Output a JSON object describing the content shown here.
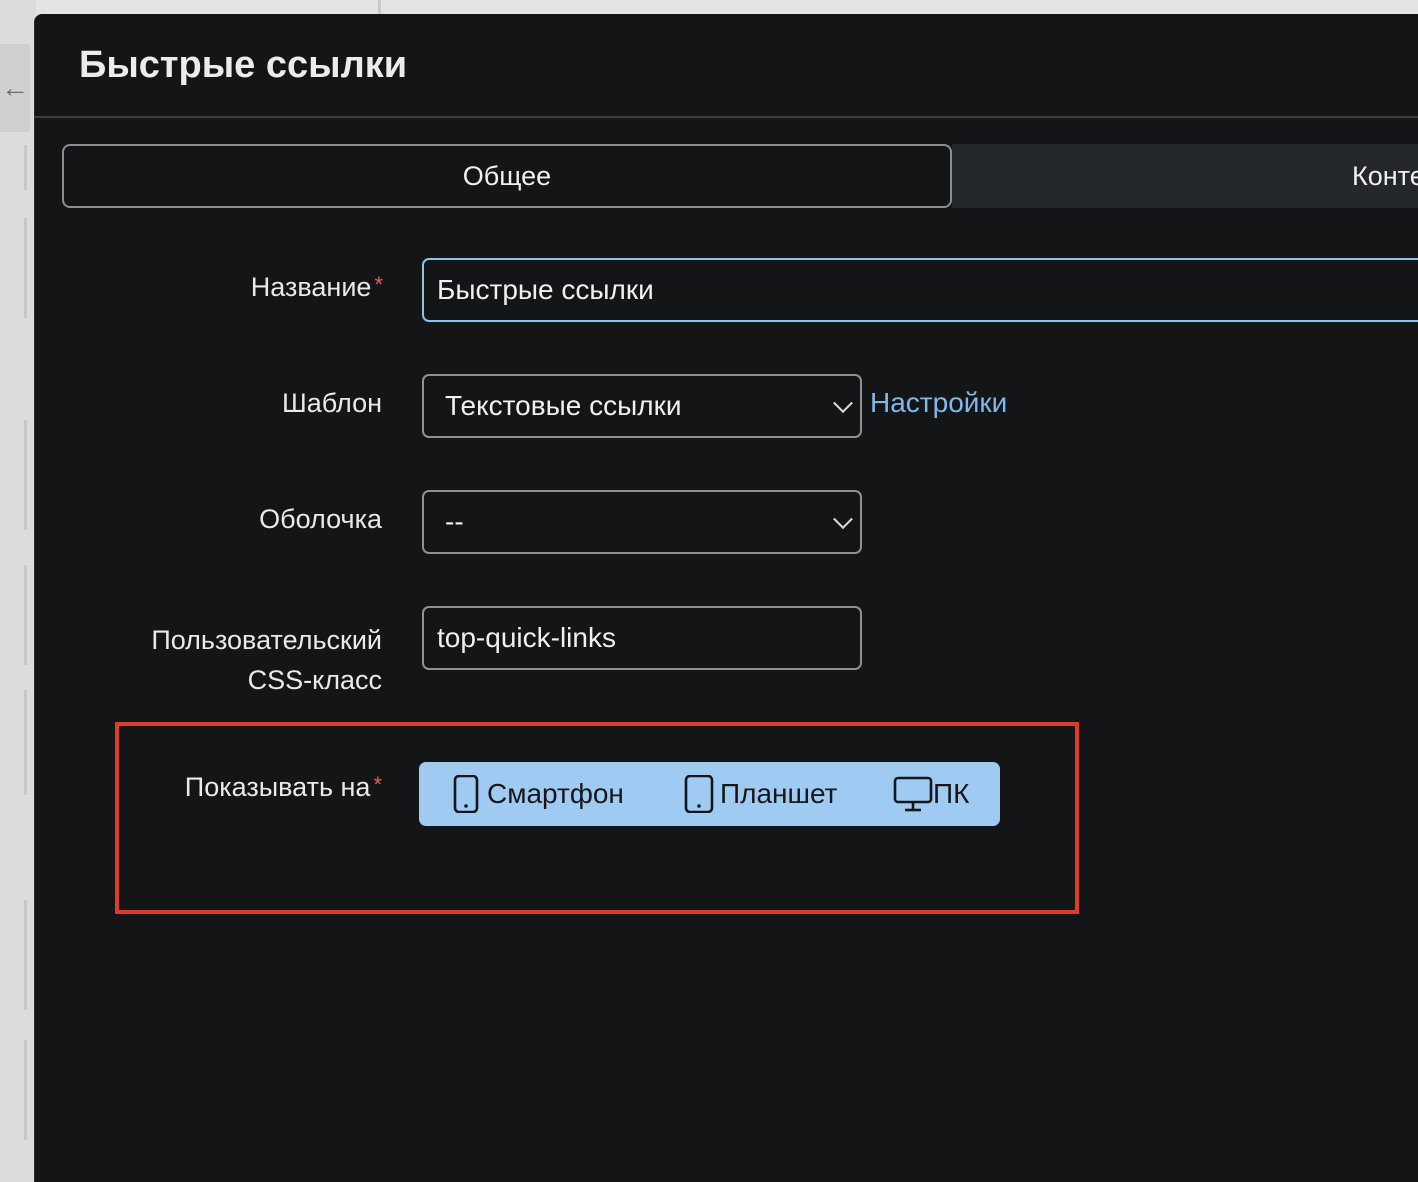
{
  "modal": {
    "title": "Быстрые ссылки"
  },
  "tabs": [
    {
      "label": "Общее",
      "active": true
    },
    {
      "label": "Конте",
      "active": false
    }
  ],
  "form": {
    "name": {
      "label": "Название",
      "required": true,
      "value": "Быстрые ссылки"
    },
    "template": {
      "label": "Шаблон",
      "value": "Текстовые ссылки",
      "settings_link": "Настройки"
    },
    "wrapper": {
      "label": "Оболочка",
      "value": "--"
    },
    "css_class": {
      "label_line1": "Пользовательский",
      "label_line2": "CSS-класс",
      "value": "top-quick-links"
    },
    "show_on": {
      "label": "Показывать на",
      "required": true,
      "options": [
        {
          "label": "Смартфон",
          "icon": "smartphone-icon",
          "selected": true
        },
        {
          "label": "Планшет",
          "icon": "tablet-icon",
          "selected": true
        },
        {
          "label": "ПК",
          "icon": "monitor-icon",
          "selected": true
        }
      ]
    }
  },
  "colors": {
    "modal_bg": "#141517",
    "selected_toggle": "#9fcbf3",
    "link": "#7fb8ea",
    "required": "#e35d5d",
    "highlight": "#e03a2a"
  }
}
